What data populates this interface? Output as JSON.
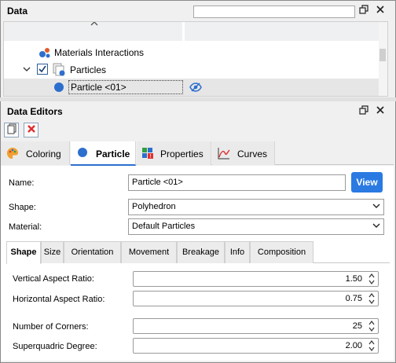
{
  "data_panel": {
    "title": "Data",
    "search_value": "",
    "header_buttons": [
      "restore-icon",
      "close-icon"
    ],
    "tree": {
      "items": [
        {
          "label": "Materials Interactions",
          "icon": "materials-interactions-icon"
        },
        {
          "label": "Particles",
          "icon": "particles-icon",
          "expanded": true,
          "checked": true
        },
        {
          "label": "Particle <01>",
          "icon": "particle-icon",
          "selected": true,
          "visibility_icon": "eye-icon"
        }
      ]
    }
  },
  "editors_panel": {
    "title": "Data Editors",
    "toolbar": [
      "new-document-icon",
      "delete-icon"
    ],
    "main_tabs": [
      {
        "label": "Coloring",
        "icon": "palette-icon",
        "active": false
      },
      {
        "label": "Particle",
        "icon": "particle-dot-icon",
        "active": true
      },
      {
        "label": "Properties",
        "icon": "properties-icon",
        "active": false
      },
      {
        "label": "Curves",
        "icon": "curves-icon",
        "active": false
      }
    ],
    "form": {
      "name_label": "Name:",
      "name_value": "Particle <01>",
      "view_button": "View",
      "shape_label": "Shape:",
      "shape_value": "Polyhedron",
      "material_label": "Material:",
      "material_value": "Default Particles"
    },
    "sub_tabs": [
      {
        "label": "Shape",
        "active": true
      },
      {
        "label": "Size",
        "active": false
      },
      {
        "label": "Orientation",
        "active": false
      },
      {
        "label": "Movement",
        "active": false
      },
      {
        "label": "Breakage",
        "active": false
      },
      {
        "label": "Info",
        "active": false
      },
      {
        "label": "Composition",
        "active": false
      }
    ],
    "shape_fields": [
      {
        "label": "Vertical Aspect Ratio:",
        "value": "1.50"
      },
      {
        "label": "Horizontal Aspect Ratio:",
        "value": "0.75"
      },
      {
        "label": "Number of Corners:",
        "value": "25"
      },
      {
        "label": "Superquadric Degree:",
        "value": "2.00"
      }
    ]
  },
  "colors": {
    "accent": "#2a7ae2",
    "particle_dot": "#2d6fcc",
    "delete_red": "#e03030"
  }
}
